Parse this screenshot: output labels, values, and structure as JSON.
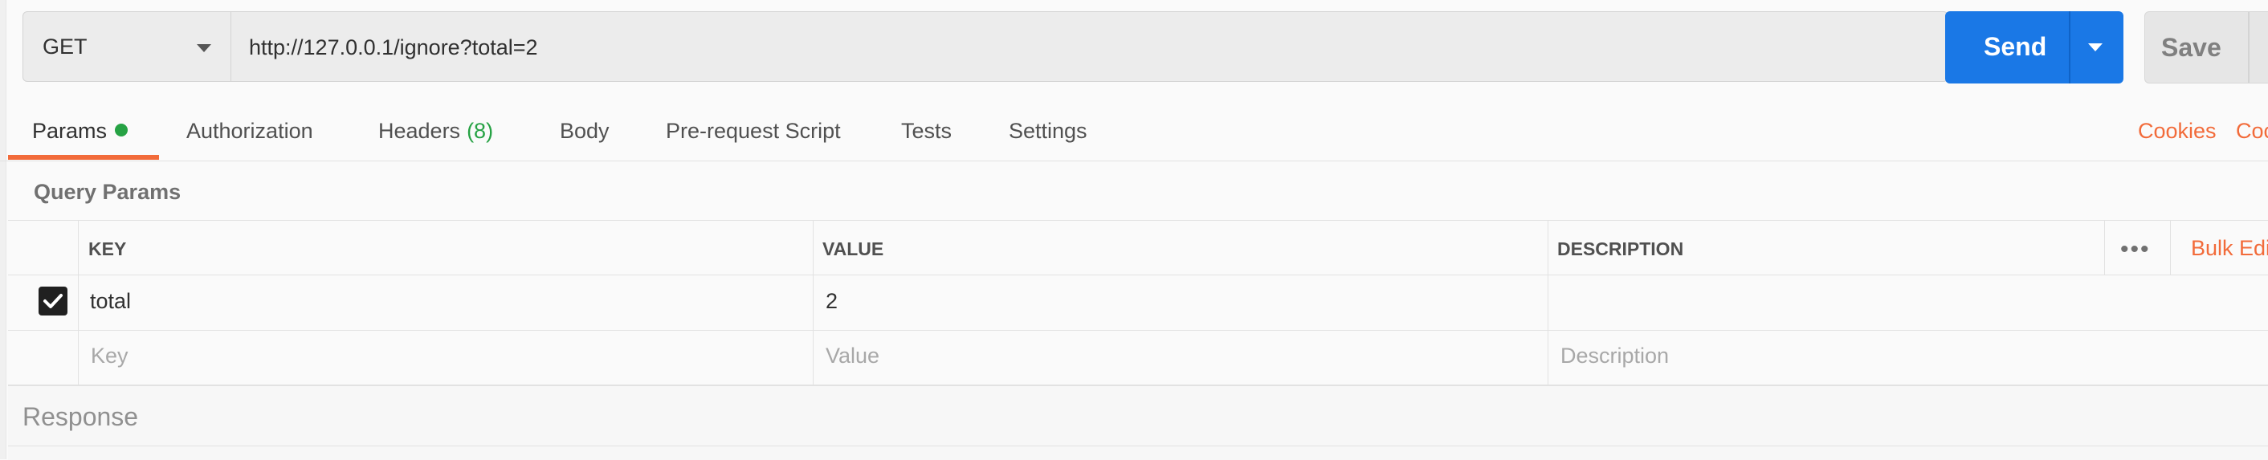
{
  "request": {
    "method": "GET",
    "url": "http://127.0.0.1/ignore?total=2",
    "send_label": "Send",
    "save_label": "Save"
  },
  "tabs": [
    {
      "label": "Params",
      "active": true,
      "has_dot": true
    },
    {
      "label": "Authorization"
    },
    {
      "label": "Headers",
      "count": "(8)"
    },
    {
      "label": "Body"
    },
    {
      "label": "Pre-request Script"
    },
    {
      "label": "Tests"
    },
    {
      "label": "Settings"
    }
  ],
  "right_links": {
    "cookies": "Cookies",
    "code": "Coc"
  },
  "params": {
    "section_title": "Query Params",
    "columns": [
      "KEY",
      "VALUE",
      "DESCRIPTION"
    ],
    "bulk_edit": "Bulk Edi",
    "rows": [
      {
        "checked": true,
        "key": "total",
        "value": "2",
        "description": ""
      }
    ],
    "placeholders": {
      "key": "Key",
      "value": "Value",
      "description": "Description"
    }
  },
  "response": {
    "title": "Response"
  },
  "colors": {
    "accent": "#f26b3a",
    "send_button": "#1a78e6",
    "status_dot": "#26a244"
  }
}
